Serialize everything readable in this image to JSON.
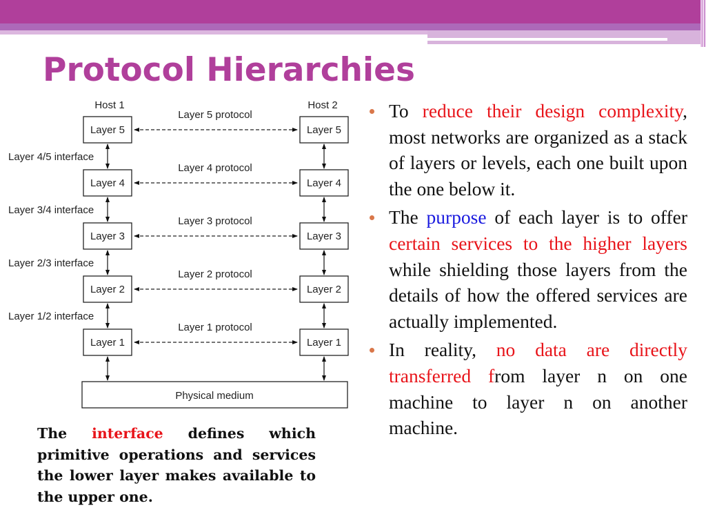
{
  "slide": {
    "title": "Protocol Hierarchies",
    "colors": {
      "accent": "#b03f9b",
      "highlight_red": "#e8141a",
      "highlight_blue": "#1a1adf",
      "bullet": "#d9774a"
    }
  },
  "diagram": {
    "hosts": [
      "Host 1",
      "Host 2"
    ],
    "layers": [
      {
        "label": "Layer 5",
        "protocol": "Layer 5 protocol"
      },
      {
        "label": "Layer 4",
        "protocol": "Layer 4 protocol"
      },
      {
        "label": "Layer 3",
        "protocol": "Layer 3 protocol"
      },
      {
        "label": "Layer 2",
        "protocol": "Layer 2 protocol"
      },
      {
        "label": "Layer 1",
        "protocol": "Layer 1 protocol"
      }
    ],
    "interfaces": [
      "Layer 4/5 interface",
      "Layer 3/4 interface",
      "Layer 2/3 interface",
      "Layer 1/2 interface"
    ],
    "medium": "Physical medium"
  },
  "caption": {
    "pre": "The ",
    "highlight": "interface",
    "post": " defines which primitive operations and services the lower layer makes available to the upper one."
  },
  "bullets": [
    {
      "segments": [
        {
          "text": "To ",
          "style": "normal"
        },
        {
          "text": "reduce their design complexity",
          "style": "red"
        },
        {
          "text": ", most networks are organized as a stack of layers or levels, each one built upon the one below it.",
          "style": "normal"
        }
      ]
    },
    {
      "segments": [
        {
          "text": "The ",
          "style": "normal"
        },
        {
          "text": "purpose",
          "style": "blue"
        },
        {
          "text": " of each layer is to offer ",
          "style": "normal"
        },
        {
          "text": "certain services to the higher layers",
          "style": "red"
        },
        {
          "text": " while shielding those layers from the details of how the offered services are actually implemented.",
          "style": "normal"
        }
      ]
    },
    {
      "segments": [
        {
          "text": "In reality, ",
          "style": "normal"
        },
        {
          "text": "no data are directly transferred f",
          "style": "red"
        },
        {
          "text": "rom layer n on one machine to layer n on another machine.",
          "style": "normal"
        }
      ]
    }
  ]
}
